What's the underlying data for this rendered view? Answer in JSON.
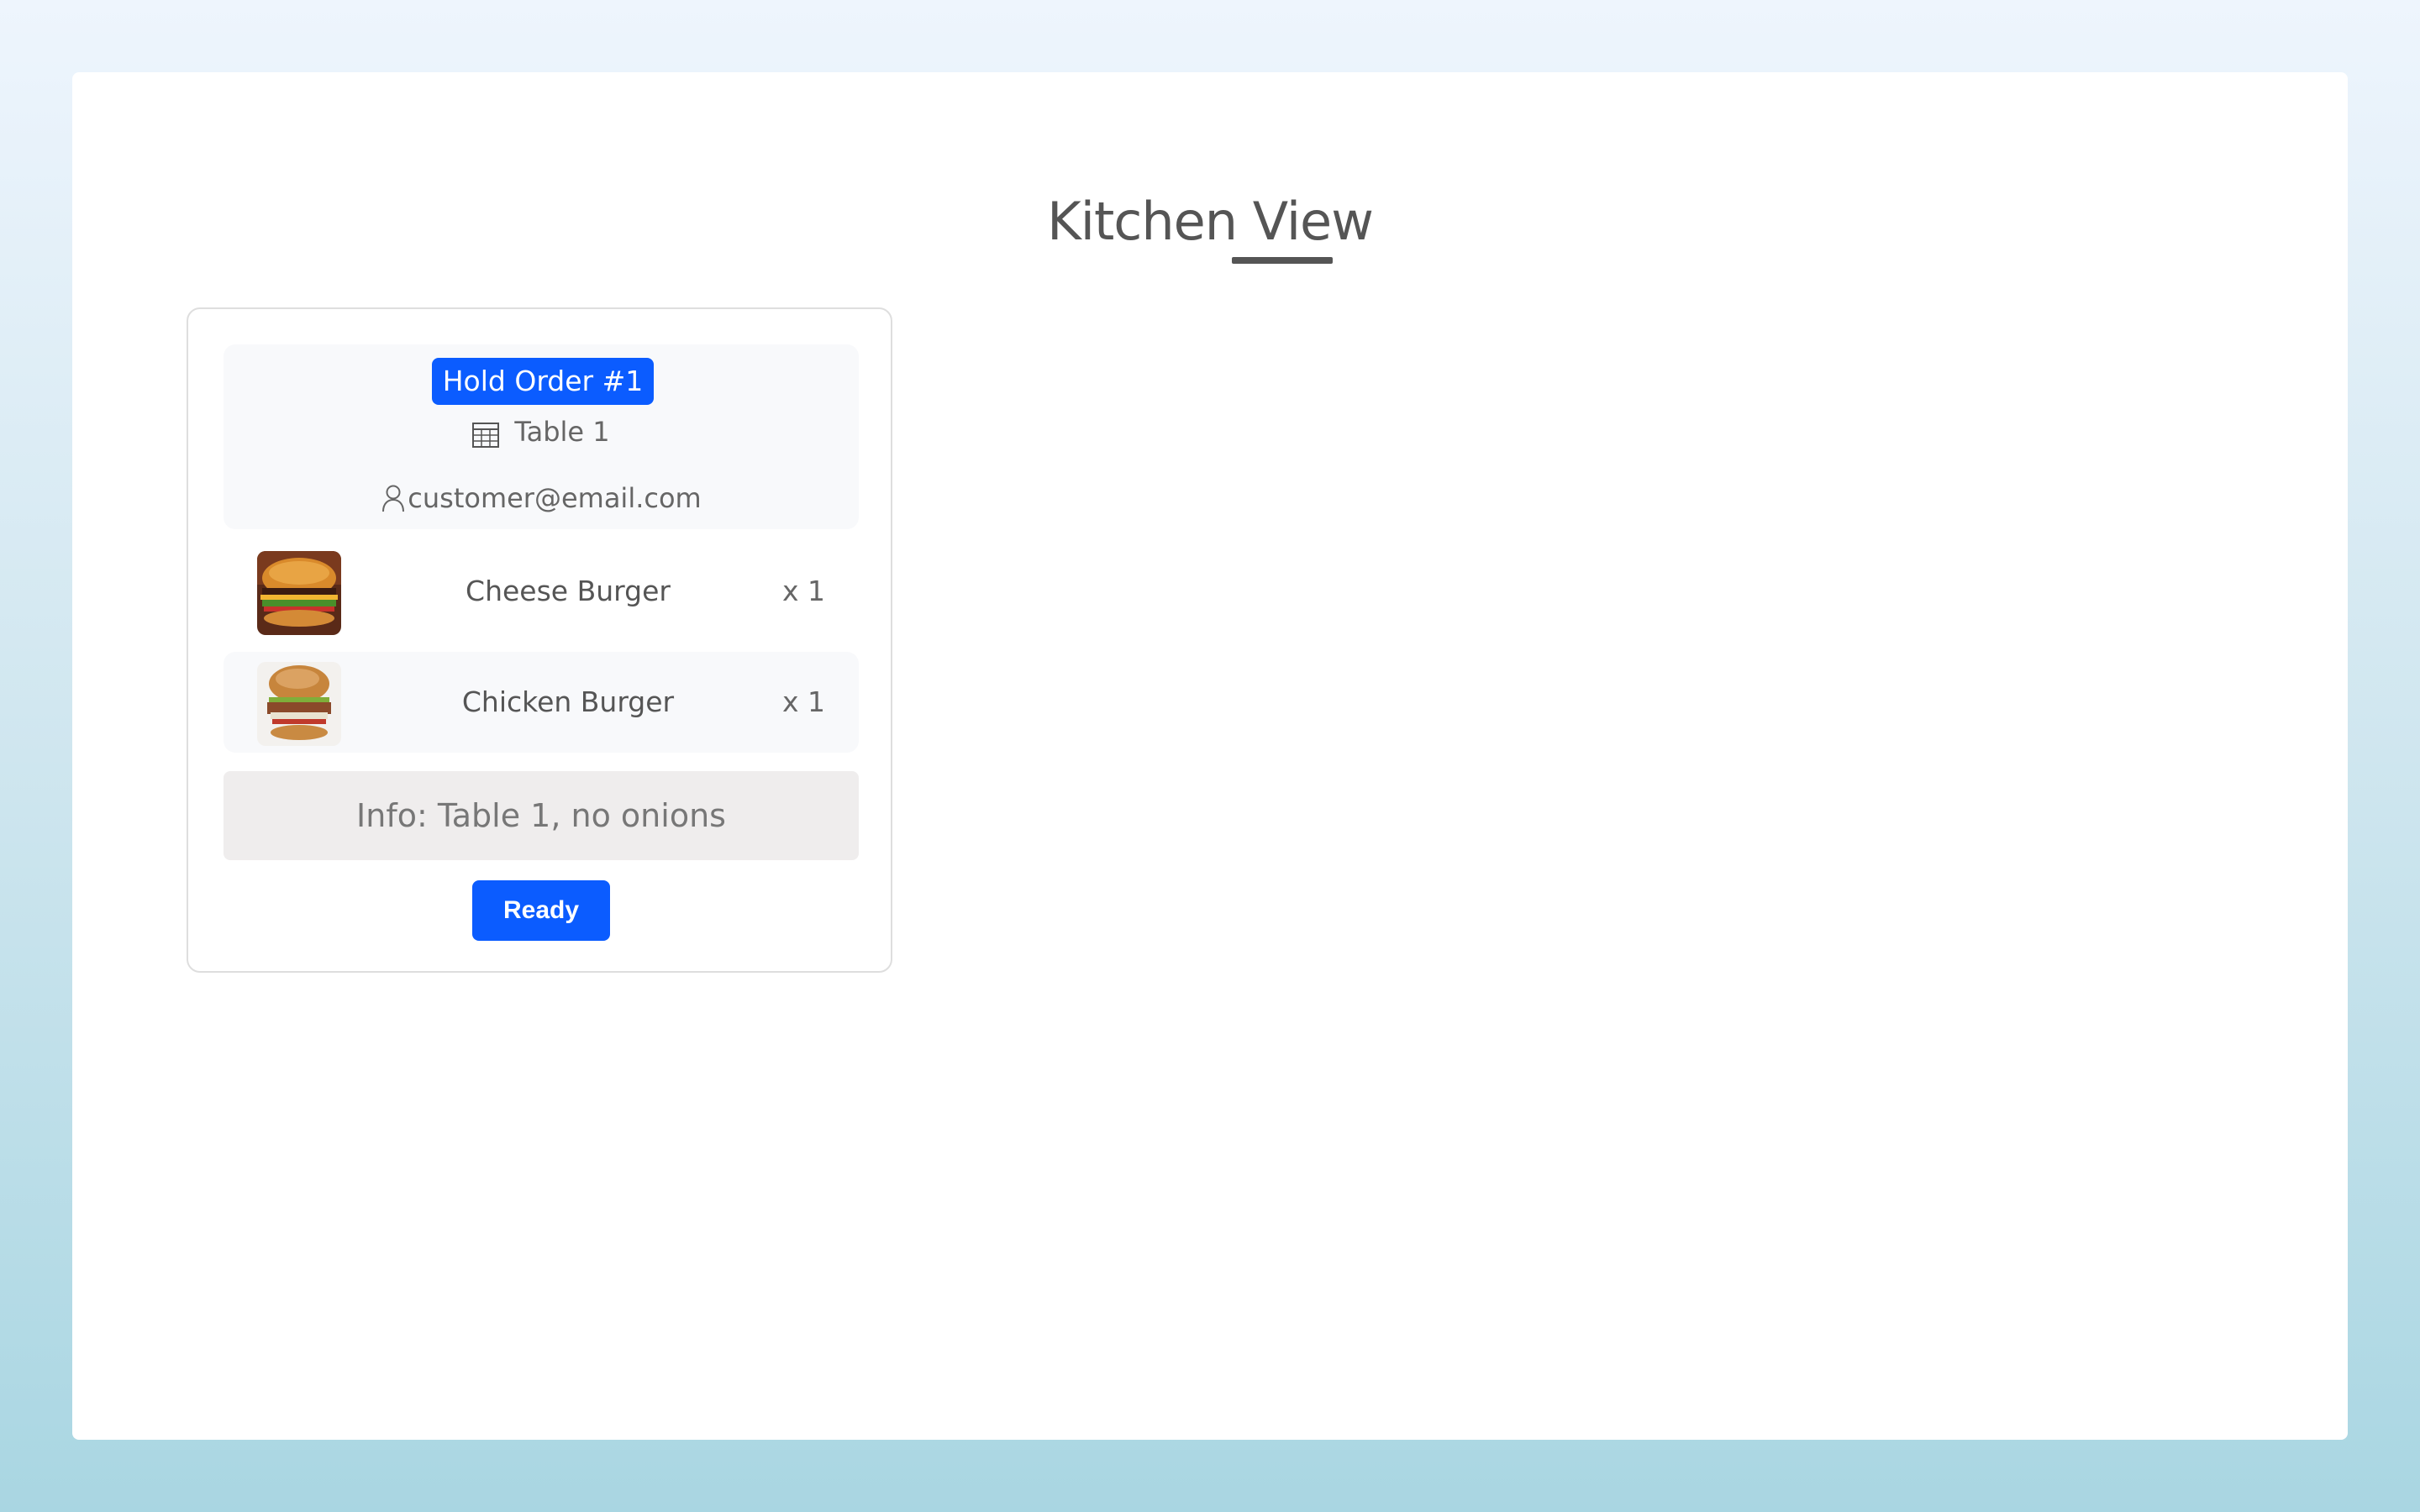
{
  "page": {
    "title": "Kitchen View"
  },
  "order": {
    "badge": "Hold Order #1",
    "table": "Table 1",
    "table_icon": "table-grid-icon",
    "customer": "customer@email.com",
    "customer_icon": "user-icon",
    "items": [
      {
        "name": "Cheese Burger",
        "qty": "x 1",
        "image": "cheese-burger-image"
      },
      {
        "name": "Chicken Burger",
        "qty": "x 1",
        "image": "chicken-burger-image"
      }
    ],
    "info": "Info: Table 1, no onions",
    "action_label": "Ready"
  },
  "colors": {
    "accent": "#0b5cff",
    "text": "#555555",
    "info_bg": "#efeded"
  }
}
